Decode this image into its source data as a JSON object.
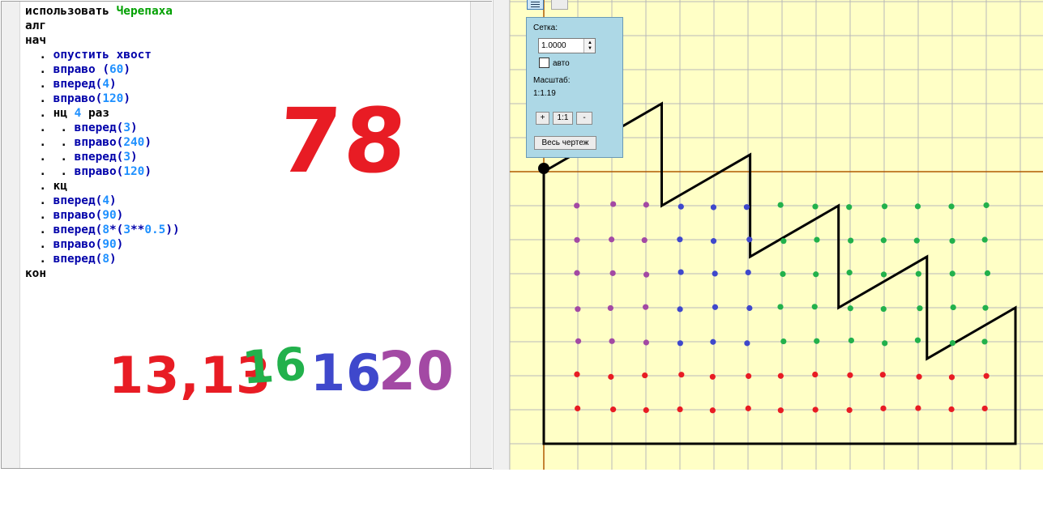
{
  "editor": {
    "lines": [
      [
        {
          "t": "использовать ",
          "c": "kw"
        },
        {
          "t": "Черепаха",
          "c": "mod"
        }
      ],
      [
        {
          "t": "алг",
          "c": "kw"
        }
      ],
      [
        {
          "t": "нач",
          "c": "kw"
        }
      ],
      [
        {
          "t": "  . ",
          "c": "dot"
        },
        {
          "t": "опустить хвост",
          "c": "cmd"
        }
      ],
      [
        {
          "t": "  . ",
          "c": "dot"
        },
        {
          "t": "вправо ",
          "c": "cmd"
        },
        {
          "t": "(",
          "c": "cmd"
        },
        {
          "t": "60",
          "c": "num"
        },
        {
          "t": ")",
          "c": "cmd"
        }
      ],
      [
        {
          "t": "  . ",
          "c": "dot"
        },
        {
          "t": "вперед",
          "c": "cmd"
        },
        {
          "t": "(",
          "c": "cmd"
        },
        {
          "t": "4",
          "c": "num"
        },
        {
          "t": ")",
          "c": "cmd"
        }
      ],
      [
        {
          "t": "  . ",
          "c": "dot"
        },
        {
          "t": "вправо",
          "c": "cmd"
        },
        {
          "t": "(",
          "c": "cmd"
        },
        {
          "t": "120",
          "c": "num"
        },
        {
          "t": ")",
          "c": "cmd"
        }
      ],
      [
        {
          "t": "  . ",
          "c": "dot"
        },
        {
          "t": "нц ",
          "c": "kw"
        },
        {
          "t": "4",
          "c": "num"
        },
        {
          "t": " раз",
          "c": "kw"
        }
      ],
      [
        {
          "t": "  .  . ",
          "c": "dot"
        },
        {
          "t": "вперед",
          "c": "cmd"
        },
        {
          "t": "(",
          "c": "cmd"
        },
        {
          "t": "3",
          "c": "num"
        },
        {
          "t": ")",
          "c": "cmd"
        }
      ],
      [
        {
          "t": "  .  . ",
          "c": "dot"
        },
        {
          "t": "вправо",
          "c": "cmd"
        },
        {
          "t": "(",
          "c": "cmd"
        },
        {
          "t": "240",
          "c": "num"
        },
        {
          "t": ")",
          "c": "cmd"
        }
      ],
      [
        {
          "t": "  .  . ",
          "c": "dot"
        },
        {
          "t": "вперед",
          "c": "cmd"
        },
        {
          "t": "(",
          "c": "cmd"
        },
        {
          "t": "3",
          "c": "num"
        },
        {
          "t": ")",
          "c": "cmd"
        }
      ],
      [
        {
          "t": "  .  . ",
          "c": "dot"
        },
        {
          "t": "вправо",
          "c": "cmd"
        },
        {
          "t": "(",
          "c": "cmd"
        },
        {
          "t": "120",
          "c": "num"
        },
        {
          "t": ")",
          "c": "cmd"
        }
      ],
      [
        {
          "t": "  . ",
          "c": "dot"
        },
        {
          "t": "кц",
          "c": "kw"
        }
      ],
      [
        {
          "t": "  . ",
          "c": "dot"
        },
        {
          "t": "вперед",
          "c": "cmd"
        },
        {
          "t": "(",
          "c": "cmd"
        },
        {
          "t": "4",
          "c": "num"
        },
        {
          "t": ")",
          "c": "cmd"
        }
      ],
      [
        {
          "t": "  . ",
          "c": "dot"
        },
        {
          "t": "вправо",
          "c": "cmd"
        },
        {
          "t": "(",
          "c": "cmd"
        },
        {
          "t": "90",
          "c": "num"
        },
        {
          "t": ")",
          "c": "cmd"
        }
      ],
      [
        {
          "t": "  . ",
          "c": "dot"
        },
        {
          "t": "вперед",
          "c": "cmd"
        },
        {
          "t": "(",
          "c": "cmd"
        },
        {
          "t": "8",
          "c": "num"
        },
        {
          "t": "*(",
          "c": "cmd"
        },
        {
          "t": "3",
          "c": "num"
        },
        {
          "t": "**",
          "c": "cmd"
        },
        {
          "t": "0.5",
          "c": "num"
        },
        {
          "t": "))",
          "c": "cmd"
        }
      ],
      [
        {
          "t": "  . ",
          "c": "dot"
        },
        {
          "t": "вправо",
          "c": "cmd"
        },
        {
          "t": "(",
          "c": "cmd"
        },
        {
          "t": "90",
          "c": "num"
        },
        {
          "t": ")",
          "c": "cmd"
        }
      ],
      [
        {
          "t": "  . ",
          "c": "dot"
        },
        {
          "t": "вперед",
          "c": "cmd"
        },
        {
          "t": "(",
          "c": "cmd"
        },
        {
          "t": "8",
          "c": "num"
        },
        {
          "t": ")",
          "c": "cmd"
        }
      ],
      [
        {
          "t": "кон",
          "c": "kw"
        }
      ]
    ]
  },
  "annotations": {
    "big_number": "78",
    "count_red": "13,13",
    "count_green": "16",
    "count_blue": "16",
    "count_purple": "20",
    "colors": {
      "red": "#e81c24",
      "green": "#22b14c",
      "blue": "#3f48cc",
      "purple": "#a349a4"
    }
  },
  "grid_popup": {
    "grid_label": "Сетка:",
    "grid_value": "1.0000",
    "auto_label": "авто",
    "auto_checked": false,
    "scale_label": "Масштаб:",
    "scale_value": "1:1.19",
    "zoom_in": "+",
    "zoom_reset": "1:1",
    "zoom_out": "-",
    "fit_button": "Весь чертеж"
  },
  "canvas": {
    "background": "#ffffc6",
    "turtle_icon": "turtle-icon"
  }
}
